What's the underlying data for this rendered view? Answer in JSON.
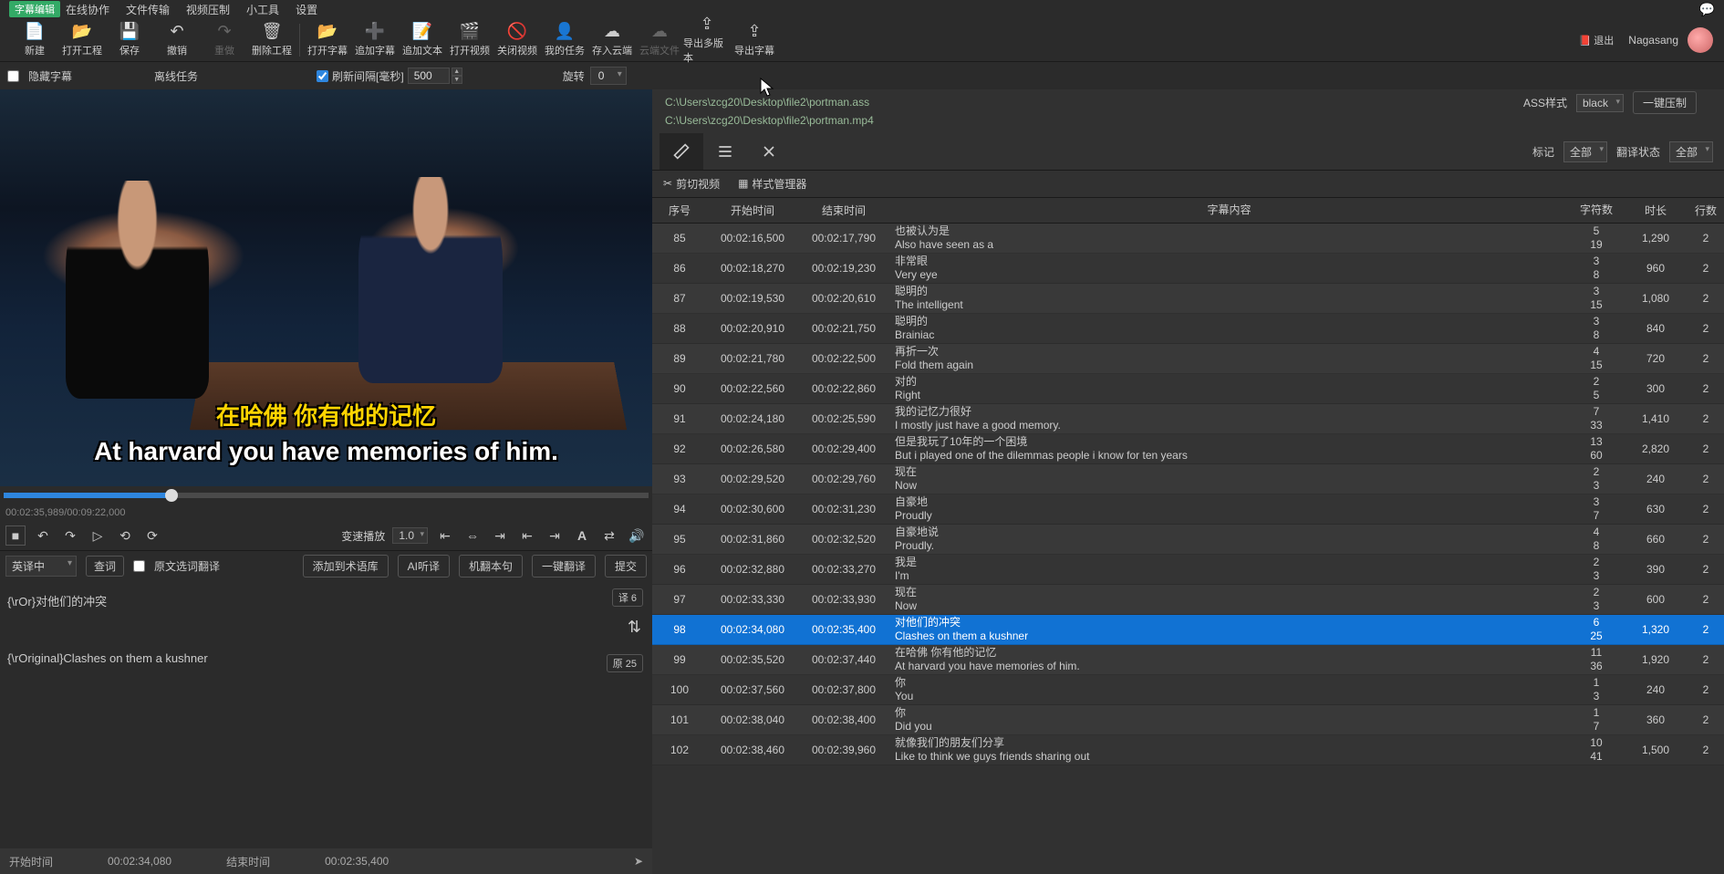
{
  "menubar": {
    "tag": "字幕编辑",
    "items": [
      "在线协作",
      "文件传输",
      "视频压制",
      "小工具",
      "设置"
    ],
    "notif_icon": "bell"
  },
  "toolbar": {
    "buttons": [
      {
        "name": "new",
        "label": "新建"
      },
      {
        "name": "open-project",
        "label": "打开工程"
      },
      {
        "name": "save",
        "label": "保存"
      },
      {
        "name": "undo",
        "label": "撤销"
      },
      {
        "name": "redo",
        "label": "重做",
        "disabled": true
      },
      {
        "name": "delete-project",
        "label": "删除工程"
      },
      {
        "name": "sep"
      },
      {
        "name": "open-subtitle",
        "label": "打开字幕"
      },
      {
        "name": "add-subtitle",
        "label": "追加字幕"
      },
      {
        "name": "append-text",
        "label": "追加文本"
      },
      {
        "name": "open-video",
        "label": "打开视频"
      },
      {
        "name": "close-video",
        "label": "关闭视频"
      },
      {
        "name": "my-tasks",
        "label": "我的任务"
      },
      {
        "name": "save-cloud",
        "label": "存入云端"
      },
      {
        "name": "cloud-file",
        "label": "云端文件",
        "disabled": true
      },
      {
        "name": "export-multi",
        "label": "导出多版本"
      },
      {
        "name": "export-subtitle",
        "label": "导出字幕"
      }
    ],
    "username": "Nagasang",
    "logout": "退出"
  },
  "optbar": {
    "hide_subtitle": "隐藏字幕",
    "offline_task": "离线任务",
    "refresh_label": "刷新间隔[毫秒]",
    "refresh_value": "500",
    "rotate_label": "旋转",
    "rotate_value": "0"
  },
  "video": {
    "sub_cn": "在哈佛  你有他的记忆",
    "sub_en": "At harvard you have memories of him.",
    "time": "00:02:35,989/00:09:22,000",
    "seek_percent": 26
  },
  "controls": {
    "speed_label": "变速播放",
    "speed_value": "1.0"
  },
  "translate": {
    "lang": "英译中",
    "lookup": "查词",
    "orig_checkbox": "原文选词翻译",
    "buttons": [
      "添加到术语库",
      "AI听译",
      "机翻本句",
      "一键翻译",
      "提交"
    ]
  },
  "edit": {
    "line1": "{\\rOr}对他们的冲突",
    "line2": "{\\rOriginal}Clashes on them a kushner",
    "badge1": "译 6",
    "badge2": "原 25",
    "time_start_label": "开始时间",
    "time_start": "00:02:34,080",
    "time_end_label": "结束时间",
    "time_end": "00:02:35,400"
  },
  "paths": {
    "p1": "C:\\Users\\zcg20\\Desktop\\file2\\portman.ass",
    "p2": "C:\\Users\\zcg20\\Desktop\\file2\\portman.mp4"
  },
  "rightopt": {
    "ass_style_label": "ASS样式",
    "ass_style_value": "black",
    "compress_btn": "一键压制"
  },
  "tabbar": {
    "mark_label": "标记",
    "mark_value": "全部",
    "trans_label": "翻译状态",
    "trans_value": "全部"
  },
  "toolrow": {
    "cut": "剪切视频",
    "style": "样式管理器"
  },
  "thead": {
    "idx": "序号",
    "start": "开始时间",
    "end": "结束时间",
    "content": "字幕内容",
    "chars": "字符数",
    "dur": "时长",
    "lines": "行数"
  },
  "rows": [
    {
      "idx": 85,
      "start": "00:02:16,500",
      "end": "00:02:17,790",
      "cn": "也被认为是",
      "en": "Also have seen as a",
      "c1": 5,
      "c2": 19,
      "dur": "1,290",
      "lines": 2
    },
    {
      "idx": 86,
      "start": "00:02:18,270",
      "end": "00:02:19,230",
      "cn": "非常眼",
      "en": "Very eye",
      "c1": 3,
      "c2": 8,
      "dur": "960",
      "lines": 2
    },
    {
      "idx": 87,
      "start": "00:02:19,530",
      "end": "00:02:20,610",
      "cn": "聪明的",
      "en": "The intelligent",
      "c1": 3,
      "c2": 15,
      "dur": "1,080",
      "lines": 2
    },
    {
      "idx": 88,
      "start": "00:02:20,910",
      "end": "00:02:21,750",
      "cn": "聪明的",
      "en": "Brainiac",
      "c1": 3,
      "c2": 8,
      "dur": "840",
      "lines": 2
    },
    {
      "idx": 89,
      "start": "00:02:21,780",
      "end": "00:02:22,500",
      "cn": "再折一次",
      "en": "Fold them again",
      "c1": 4,
      "c2": 15,
      "dur": "720",
      "lines": 2
    },
    {
      "idx": 90,
      "start": "00:02:22,560",
      "end": "00:02:22,860",
      "cn": "对的",
      "en": "Right",
      "c1": 2,
      "c2": 5,
      "dur": "300",
      "lines": 2
    },
    {
      "idx": 91,
      "start": "00:02:24,180",
      "end": "00:02:25,590",
      "cn": "我的记忆力很好",
      "en": "I mostly just have a good memory.",
      "c1": 7,
      "c2": 33,
      "dur": "1,410",
      "lines": 2
    },
    {
      "idx": 92,
      "start": "00:02:26,580",
      "end": "00:02:29,400",
      "cn": "但是我玩了10年的一个困境",
      "en": "But i played one of the dilemmas people i know for ten years",
      "c1": 13,
      "c2": 60,
      "dur": "2,820",
      "lines": 2
    },
    {
      "idx": 93,
      "start": "00:02:29,520",
      "end": "00:02:29,760",
      "cn": "现在",
      "en": "Now",
      "c1": 2,
      "c2": 3,
      "dur": "240",
      "lines": 2
    },
    {
      "idx": 94,
      "start": "00:02:30,600",
      "end": "00:02:31,230",
      "cn": "自豪地",
      "en": "Proudly",
      "c1": 3,
      "c2": 7,
      "dur": "630",
      "lines": 2
    },
    {
      "idx": 95,
      "start": "00:02:31,860",
      "end": "00:02:32,520",
      "cn": "自豪地说",
      "en": "Proudly.",
      "c1": 4,
      "c2": 8,
      "dur": "660",
      "lines": 2
    },
    {
      "idx": 96,
      "start": "00:02:32,880",
      "end": "00:02:33,270",
      "cn": "我是",
      "en": "I'm",
      "c1": 2,
      "c2": 3,
      "dur": "390",
      "lines": 2
    },
    {
      "idx": 97,
      "start": "00:02:33,330",
      "end": "00:02:33,930",
      "cn": "现在",
      "en": "Now",
      "c1": 2,
      "c2": 3,
      "dur": "600",
      "lines": 2
    },
    {
      "idx": 98,
      "start": "00:02:34,080",
      "end": "00:02:35,400",
      "cn": "对他们的冲突",
      "en": "Clashes on them a kushner",
      "c1": 6,
      "c2": 25,
      "dur": "1,320",
      "lines": 2,
      "selected": true
    },
    {
      "idx": 99,
      "start": "00:02:35,520",
      "end": "00:02:37,440",
      "cn": "在哈佛  你有他的记忆",
      "en": "At harvard you have memories of him.",
      "c1": 11,
      "c2": 36,
      "dur": "1,920",
      "lines": 2
    },
    {
      "idx": 100,
      "start": "00:02:37,560",
      "end": "00:02:37,800",
      "cn": "你",
      "en": "You",
      "c1": 1,
      "c2": 3,
      "dur": "240",
      "lines": 2
    },
    {
      "idx": 101,
      "start": "00:02:38,040",
      "end": "00:02:38,400",
      "cn": "你",
      "en": "Did you",
      "c1": 1,
      "c2": 7,
      "dur": "360",
      "lines": 2
    },
    {
      "idx": 102,
      "start": "00:02:38,460",
      "end": "00:02:39,960",
      "cn": "就像我们的朋友们分享",
      "en": "Like to think we guys friends sharing out",
      "c1": 10,
      "c2": 41,
      "dur": "1,500",
      "lines": 2
    }
  ]
}
